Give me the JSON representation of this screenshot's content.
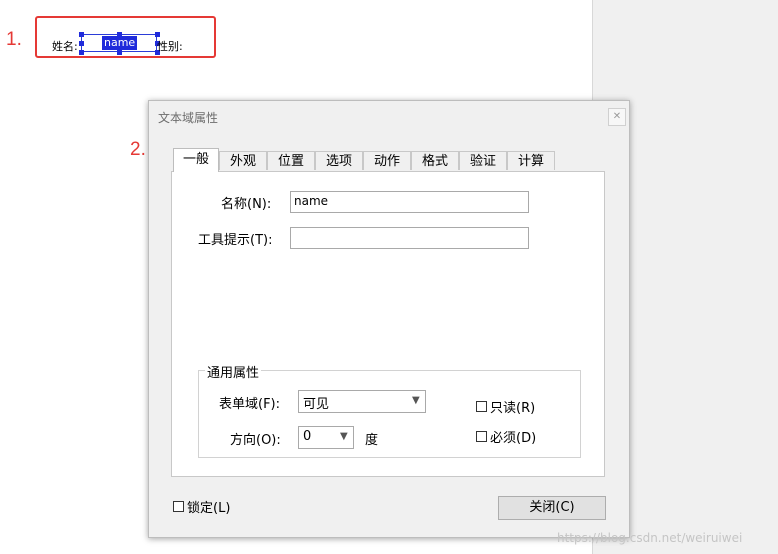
{
  "steps": {
    "one": "1.",
    "two": "2."
  },
  "preview": {
    "name_label": "姓名:",
    "field_value": "name",
    "gender_label": "性别:"
  },
  "dialog": {
    "title": "文本域属性",
    "close_icon": "close-x-icon",
    "tabs": [
      "一般",
      "外观",
      "位置",
      "选项",
      "动作",
      "格式",
      "验证",
      "计算"
    ],
    "active_tab": 0,
    "general": {
      "name_label": "名称(N):",
      "name_value": "name",
      "tooltip_label": "工具提示(T):",
      "tooltip_value": "",
      "common_props": {
        "legend": "通用属性",
        "form_field_label": "表单域(F):",
        "form_field_value": "可见",
        "direction_label": "方向(O):",
        "direction_value": "0",
        "degree_label": "度",
        "readonly_label": "只读(R)",
        "readonly_checked": false,
        "required_label": "必须(D)",
        "required_checked": false
      }
    },
    "lock_label": "锁定(L)",
    "lock_checked": false,
    "close_button": "关闭(C)"
  },
  "watermark": "https://blog.csdn.net/weiruiwei"
}
